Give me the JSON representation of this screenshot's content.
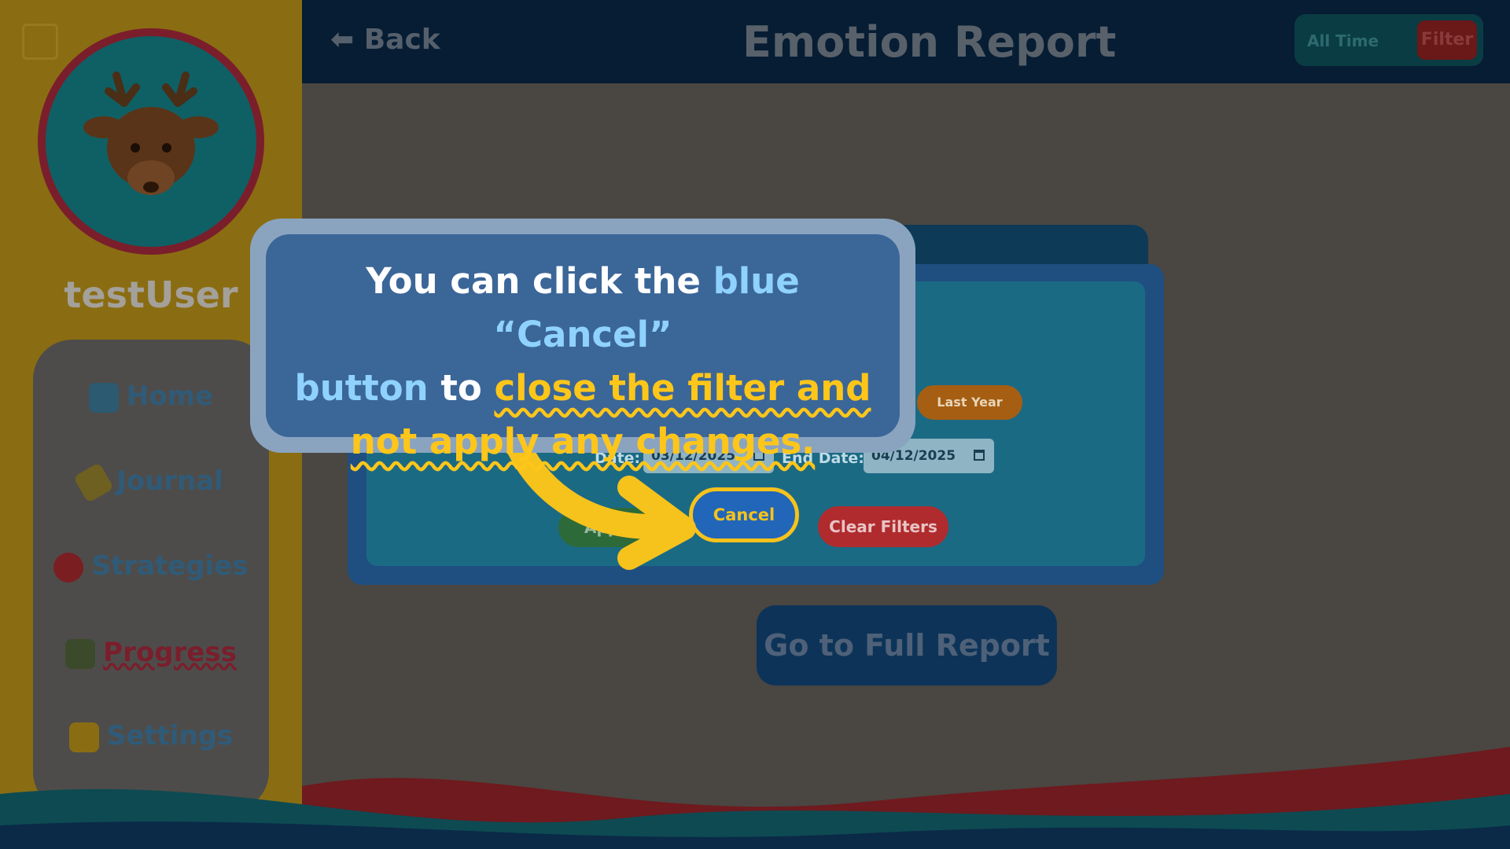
{
  "sidebar": {
    "username": "testUser",
    "items": [
      {
        "label": "Home",
        "icon": "house-icon"
      },
      {
        "label": "Journal",
        "icon": "pencil-icon"
      },
      {
        "label": "Strategies",
        "icon": "balloon-icon"
      },
      {
        "label": "Progress",
        "icon": "chart-icon",
        "active": true
      },
      {
        "label": "Settings",
        "icon": "gear-icon"
      }
    ]
  },
  "header": {
    "back_label": "Back",
    "title": "Emotion Report",
    "range_label": "All Time",
    "filter_label": "Filter"
  },
  "filter_dialog": {
    "last_year_label": "Last Year",
    "start_date_label": "Date:",
    "start_date_value": "03/12/2025",
    "end_date_label": "End Date:",
    "end_date_value": "04/12/2025",
    "apply_label": "Apply",
    "cancel_label": "Cancel",
    "clear_label": "Clear Filters"
  },
  "full_report_label": "Go to Full Report",
  "tooltip": {
    "part1": "You can click the ",
    "part2": "blue “Cancel”",
    "part3": "button",
    "part4": " to ",
    "part5": "close the filter and",
    "part6": "not apply any changes."
  },
  "colors": {
    "accent_yellow": "#ffc61a",
    "cancel_blue": "#2166b8",
    "clear_red": "#b02b2e",
    "tooltip_bg": "#3b6698"
  }
}
